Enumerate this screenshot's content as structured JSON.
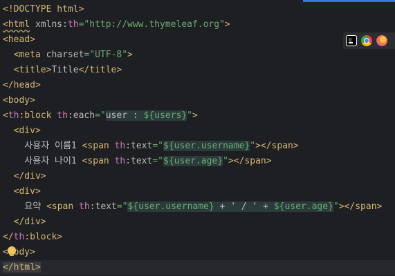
{
  "editor": {
    "lines": [
      [
        {
          "t": "<!DOCTYPE html>",
          "c": "tag"
        }
      ],
      [
        {
          "t": "<html",
          "c": "tagwarn"
        },
        {
          "t": " ",
          "c": "text"
        },
        {
          "t": "xmlns:",
          "c": "attr"
        },
        {
          "t": "th",
          "c": "ns"
        },
        {
          "t": "=\"http://www.thymeleaf.org\"",
          "c": "val"
        },
        {
          "t": ">",
          "c": "tag"
        }
      ],
      [
        {
          "t": "<head>",
          "c": "tag"
        }
      ],
      [
        {
          "t": "  ",
          "c": "text"
        },
        {
          "t": "<meta ",
          "c": "tag"
        },
        {
          "t": "charset",
          "c": "attr"
        },
        {
          "t": "=\"UTF-8\"",
          "c": "val"
        },
        {
          "t": ">",
          "c": "tag"
        }
      ],
      [
        {
          "t": "  ",
          "c": "text"
        },
        {
          "t": "<title>",
          "c": "tag"
        },
        {
          "t": "Title",
          "c": "text"
        },
        {
          "t": "</title>",
          "c": "tag"
        }
      ],
      [
        {
          "t": "</head>",
          "c": "tag"
        }
      ],
      [
        {
          "t": "<body>",
          "c": "tag"
        }
      ],
      [
        {
          "t": "<",
          "c": "tag"
        },
        {
          "t": "th",
          "c": "ns"
        },
        {
          "t": ":block ",
          "c": "tag"
        },
        {
          "t": "th",
          "c": "ns"
        },
        {
          "t": ":each",
          "c": "attr"
        },
        {
          "t": "=\"",
          "c": "val"
        },
        {
          "t": "user : ",
          "c": "expr"
        },
        {
          "t": "${users}",
          "c": "exprval"
        },
        {
          "t": "\"",
          "c": "val"
        },
        {
          "t": ">",
          "c": "tag"
        }
      ],
      [
        {
          "t": "  ",
          "c": "text"
        },
        {
          "t": "<div>",
          "c": "tag"
        }
      ],
      [
        {
          "t": "    사용자 이름1 ",
          "c": "text"
        },
        {
          "t": "<span ",
          "c": "tag"
        },
        {
          "t": "th",
          "c": "ns"
        },
        {
          "t": ":text",
          "c": "attr"
        },
        {
          "t": "=\"",
          "c": "val"
        },
        {
          "t": "${user.username}",
          "c": "exprval"
        },
        {
          "t": "\"",
          "c": "val"
        },
        {
          "t": "></span>",
          "c": "tag"
        }
      ],
      [
        {
          "t": "    사용자 나이1 ",
          "c": "text"
        },
        {
          "t": "<span ",
          "c": "tag"
        },
        {
          "t": "th",
          "c": "ns"
        },
        {
          "t": ":text",
          "c": "attr"
        },
        {
          "t": "=\"",
          "c": "val"
        },
        {
          "t": "${user.age}",
          "c": "exprval"
        },
        {
          "t": "\"",
          "c": "val"
        },
        {
          "t": "></span>",
          "c": "tag"
        }
      ],
      [
        {
          "t": "  ",
          "c": "text"
        },
        {
          "t": "</div>",
          "c": "tag"
        }
      ],
      [
        {
          "t": "  ",
          "c": "text"
        },
        {
          "t": "<div>",
          "c": "tag"
        }
      ],
      [
        {
          "t": "    요약 ",
          "c": "text"
        },
        {
          "t": "<span ",
          "c": "tag"
        },
        {
          "t": "th",
          "c": "ns"
        },
        {
          "t": ":text",
          "c": "attr"
        },
        {
          "t": "=\"",
          "c": "val"
        },
        {
          "t": "${user.username}",
          "c": "exprval"
        },
        {
          "t": " + ' / ' + ",
          "c": "expr"
        },
        {
          "t": "${user.age}",
          "c": "exprval"
        },
        {
          "t": "\"",
          "c": "val"
        },
        {
          "t": "></span>",
          "c": "tag"
        }
      ],
      [
        {
          "t": "  ",
          "c": "text"
        },
        {
          "t": "</div>",
          "c": "tag"
        }
      ],
      [
        {
          "t": "</",
          "c": "tag"
        },
        {
          "t": "th",
          "c": "ns"
        },
        {
          "t": ":block>",
          "c": "tag"
        }
      ],
      [
        {
          "t": "<",
          "c": "tag"
        },
        {
          "t": "body>",
          "c": "tag"
        }
      ],
      [
        {
          "t": "</html>",
          "c": "tagbox"
        }
      ]
    ],
    "current_line": 17
  },
  "browser_icons": [
    "intellij-icon",
    "chrome-icon",
    "firefox-icon"
  ],
  "colors": {
    "accent": "#3574f0",
    "background": "#1e1f22"
  }
}
